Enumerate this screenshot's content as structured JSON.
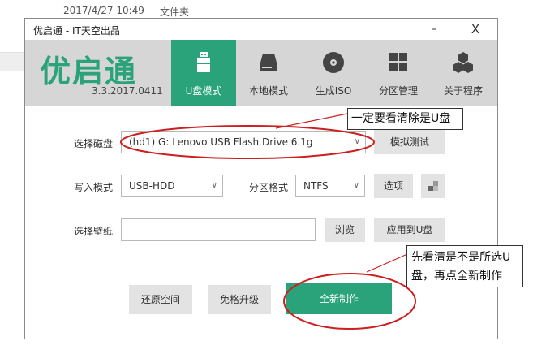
{
  "background": {
    "date_text": "2017/4/27 10:49",
    "type_text": "文件夹"
  },
  "window": {
    "title": "优启通 - IT天空出品",
    "minimize_glyph": "–",
    "close_glyph": "X"
  },
  "header": {
    "logo": "优启通",
    "version": "3.3.2017.0411",
    "accent_color": "#2aa37a",
    "nav": [
      {
        "label": "U盘模式",
        "icon": "usb-drive-icon",
        "active": true
      },
      {
        "label": "本地模式",
        "icon": "hard-disk-icon",
        "active": false
      },
      {
        "label": "生成ISO",
        "icon": "disc-icon",
        "active": false
      },
      {
        "label": "分区管理",
        "icon": "partition-grid-icon",
        "active": false
      },
      {
        "label": "关于程序",
        "icon": "hexagon-cluster-icon",
        "active": false
      }
    ]
  },
  "form": {
    "disk_label": "选择磁盘",
    "disk_value": "(hd1) G: Lenovo USB Flash Drive 6.1g",
    "simulate_button": "模拟测试",
    "write_mode_label": "写入模式",
    "write_mode_value": "USB-HDD",
    "partition_format_label": "分区格式",
    "partition_format_value": "NTFS",
    "options_button": "选项",
    "wallpaper_label": "选择壁纸",
    "wallpaper_value": "",
    "browse_button": "浏览",
    "apply_to_usb_button": "应用到U盘"
  },
  "actions": {
    "restore_space": "还原空间",
    "upgrade_no_format": "免格升级",
    "new_create": "全新制作"
  },
  "annotations": {
    "callout_top": "一定要看清除是U盘",
    "callout_bottom_line1": "先看清是不是所选U",
    "callout_bottom_line2": "盘，再点全新制作",
    "annotation_color": "#cc1f1f"
  }
}
